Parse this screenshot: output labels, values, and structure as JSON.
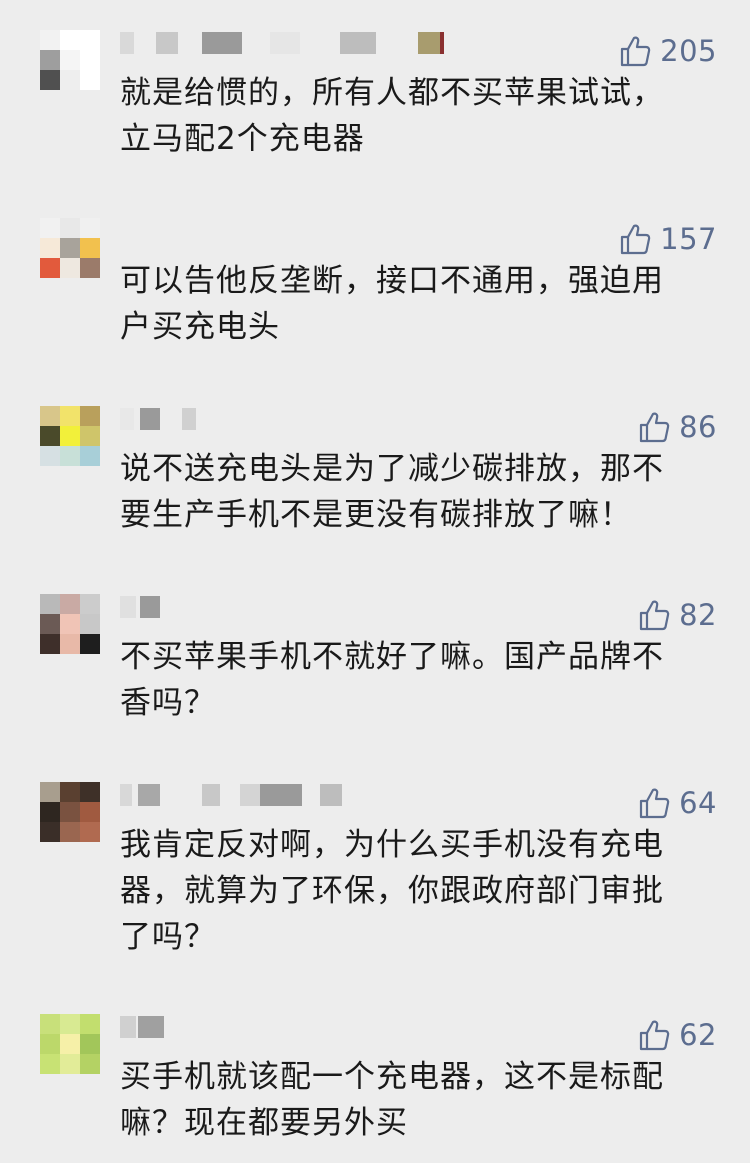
{
  "comments": [
    {
      "likes": "205",
      "text": "就是给惯的，所有人都不买苹果试试，\n立马配2个充电器",
      "avatar_colors": [
        "#f2f2f2",
        "#ffffff",
        "#ffffff",
        "#9e9e9e",
        "#f5f5f5",
        "#ffffff",
        "#505050",
        "#eeeeee",
        "#ffffff"
      ],
      "name_blocks": [
        [
          "#d9d9d9",
          0,
          14
        ],
        [
          "#c8c8c8",
          36,
          22
        ],
        [
          "#9a9a9a",
          82,
          40
        ],
        [
          "#e6e6e6",
          150,
          30
        ],
        [
          "#bdbdbd",
          220,
          36
        ],
        [
          "#a89c6e",
          298,
          22
        ],
        [
          "#8a3030",
          320,
          4
        ]
      ]
    },
    {
      "likes": "157",
      "text": "可以告他反垄断，接口不通用，强迫用\n户买充电头",
      "avatar_colors": [
        "#f1f1f1",
        "#e8e8e8",
        "#f0f0f0",
        "#f6e9d8",
        "#a8a39b",
        "#f2c14e",
        "#e25a3c",
        "#eee8e0",
        "#9b7b6a"
      ],
      "name_blocks": []
    },
    {
      "likes": "86",
      "text": "说不送充电头是为了减少碳排放，那不\n要生产手机不是更没有碳排放了嘛！",
      "avatar_colors": [
        "#d8c68a",
        "#f2e36a",
        "#b9a05c",
        "#4a4a2a",
        "#f2f03a",
        "#cfc56a",
        "#d6e0e3",
        "#c8e0d8",
        "#a8cfd8"
      ],
      "name_blocks": [
        [
          "#e8e8e8",
          0,
          14
        ],
        [
          "#9a9a9a",
          20,
          20
        ],
        [
          "#d0d0d0",
          62,
          14
        ]
      ]
    },
    {
      "likes": "82",
      "text": "不买苹果手机不就好了嘛。国产品牌不\n香吗？",
      "avatar_colors": [
        "#b9b9b9",
        "#c9aaa4",
        "#cccccc",
        "#6b5a55",
        "#f0c4b6",
        "#c8c8c8",
        "#3e2f2a",
        "#e8b9a8",
        "#1e1e1e"
      ],
      "name_blocks": [
        [
          "#e0e0e0",
          0,
          16
        ],
        [
          "#9a9a9a",
          20,
          20
        ]
      ]
    },
    {
      "likes": "64",
      "text": "我肯定反对啊，为什么买手机没有充电\n器，就算为了环保，你跟政府部门审批\n了吗？",
      "avatar_colors": [
        "#a89e8e",
        "#5a4030",
        "#3e3028",
        "#2e2620",
        "#7a5240",
        "#a05a40",
        "#3a2e28",
        "#9a6650",
        "#b06a50"
      ],
      "name_blocks": [
        [
          "#d8d8d8",
          0,
          12
        ],
        [
          "#a8a8a8",
          18,
          22
        ],
        [
          "#c8c8c8",
          82,
          18
        ],
        [
          "#d4d4d4",
          120,
          20
        ],
        [
          "#9a9a9a",
          140,
          42
        ],
        [
          "#bdbdbd",
          200,
          22
        ]
      ]
    },
    {
      "likes": "62",
      "text": "买手机就该配一个充电器，这不是标配\n嘛？现在都要另外买",
      "avatar_colors": [
        "#c8e07a",
        "#d8ea92",
        "#c2de6e",
        "#bcd86a",
        "#f6f0a8",
        "#a2c65a",
        "#c8e274",
        "#e2ec98",
        "#b4d264"
      ],
      "name_blocks": [
        [
          "#d0d0d0",
          0,
          16
        ],
        [
          "#a0a0a0",
          18,
          26
        ]
      ]
    }
  ]
}
